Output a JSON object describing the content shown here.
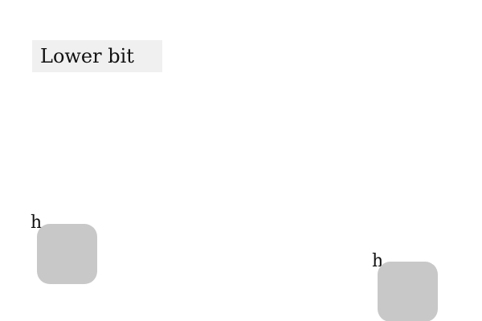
{
  "header": {
    "label": "Lower bit"
  },
  "tiles": [
    {
      "label": "h",
      "color": "#c8c8c8"
    },
    {
      "label": "h",
      "color": "#c8c8c8"
    }
  ]
}
